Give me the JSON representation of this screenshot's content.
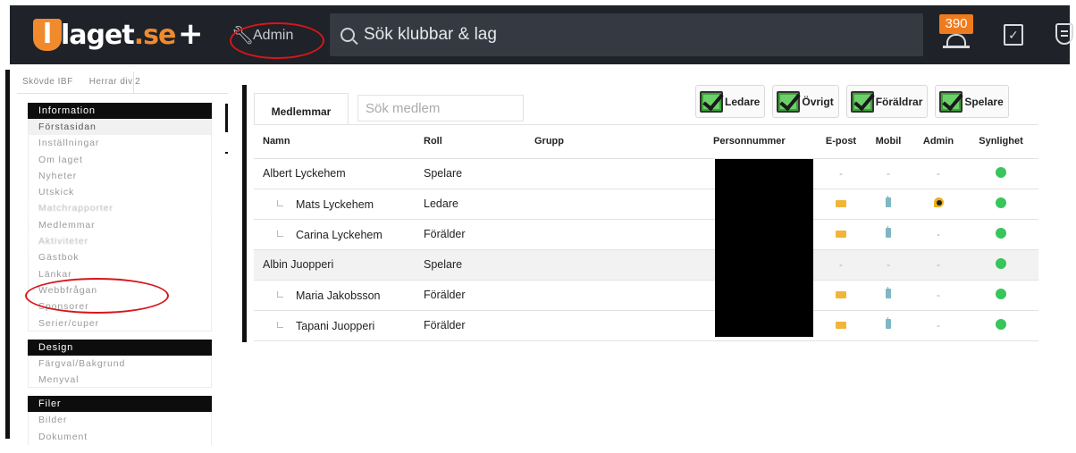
{
  "topbar": {
    "logo_main": "laget",
    "logo_tld": ".se",
    "plus_label": "+",
    "admin_label": "Admin",
    "search_placeholder": "Sök klubbar & lag",
    "notification_count": "390",
    "colors": {
      "bar": "#1f2228",
      "accent": "#f08a2c",
      "badge": "#f07b1d"
    }
  },
  "breadcrumbs": [
    "Skövde IBF",
    "Herrar div.2"
  ],
  "sidebar": {
    "groups": [
      {
        "header": "Information",
        "items": [
          "Förstasidan",
          "Inställningar",
          "Om laget",
          "Nyheter",
          "Utskick",
          "Matchrapporter",
          "Medlemmar",
          "Aktiviteter",
          "Gästbok",
          "Länkar",
          "Webbfrågan",
          "Sponsorer",
          "Serier/cuper"
        ]
      },
      {
        "header": "Design",
        "items": [
          "Färgval/Bakgrund",
          "Menyval"
        ]
      },
      {
        "header": "Filer",
        "items": [
          "Bilder",
          "Dokument"
        ]
      }
    ]
  },
  "main": {
    "tab_label": "Medlemmar",
    "member_search_placeholder": "Sök medlem",
    "filters": [
      "Ledare",
      "Övrigt",
      "Föräldrar",
      "Spelare"
    ],
    "columns": [
      "Namn",
      "Roll",
      "Grupp",
      "Personnummer",
      "E-post",
      "Mobil",
      "Admin",
      "Synlighet"
    ],
    "rows": [
      {
        "name": "Albert Lyckehem",
        "role": "Spelare",
        "child": false,
        "mail": "-",
        "mobile": "-",
        "admin": "-",
        "highlight": false
      },
      {
        "name": "Mats Lyckehem",
        "role": "Ledare",
        "child": true,
        "mail": "mail-icon",
        "mobile": "phone-icon",
        "admin": "admin-key-icon",
        "highlight": false
      },
      {
        "name": "Carina Lyckehem",
        "role": "Förälder",
        "child": true,
        "mail": "mail-icon",
        "mobile": "phone-icon",
        "admin": "-",
        "highlight": false
      },
      {
        "name": "Albin Juopperi",
        "role": "Spelare",
        "child": false,
        "mail": "-",
        "mobile": "-",
        "admin": "-",
        "highlight": true
      },
      {
        "name": "Maria Jakobsson",
        "role": "Förälder",
        "child": true,
        "mail": "mail-icon",
        "mobile": "phone-icon",
        "admin": "-",
        "highlight": false
      },
      {
        "name": "Tapani Juopperi",
        "role": "Förälder",
        "child": true,
        "mail": "mail-icon",
        "mobile": "phone-icon",
        "admin": "-",
        "highlight": false
      }
    ],
    "visibility_color": "#38c55b"
  }
}
